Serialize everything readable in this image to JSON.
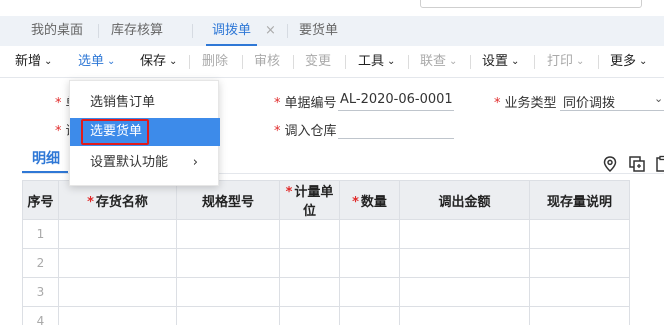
{
  "tabs": [
    {
      "label": "我的桌面",
      "active": false
    },
    {
      "label": "库存核算",
      "active": false
    },
    {
      "label": "调拨单",
      "active": true,
      "closable": true
    },
    {
      "label": "要货单",
      "active": false
    }
  ],
  "tab_close_glyph": "×",
  "toolbar": {
    "items": [
      {
        "label": "新增",
        "dropdown": true,
        "disabled": false
      },
      {
        "label": "选单",
        "dropdown": true,
        "disabled": false,
        "active": true
      },
      {
        "label": "保存",
        "dropdown": true,
        "disabled": false
      },
      {
        "label": "删除",
        "dropdown": false,
        "disabled": true
      },
      {
        "label": "审核",
        "dropdown": false,
        "disabled": true
      },
      {
        "label": "变更",
        "dropdown": false,
        "disabled": true
      },
      {
        "label": "工具",
        "dropdown": true,
        "disabled": false
      },
      {
        "label": "联查",
        "dropdown": true,
        "disabled": true
      },
      {
        "label": "设置",
        "dropdown": true,
        "disabled": false
      },
      {
        "label": "打印",
        "dropdown": true,
        "disabled": true
      },
      {
        "label": "更多",
        "dropdown": true,
        "disabled": false
      }
    ]
  },
  "form": {
    "doc_no_label": "单据编号",
    "doc_no_value": "AL-2020-06-0001",
    "biz_type_label": "业务类型",
    "biz_type_value": "同价调拨",
    "in_warehouse_label": "调入仓库",
    "in_warehouse_value": "",
    "left_label_1_partial": "单",
    "left_label_2_partial": "调"
  },
  "detail_tab": "明细",
  "grid": {
    "columns": [
      {
        "label": "序号",
        "required": false
      },
      {
        "label": "存货名称",
        "required": true
      },
      {
        "label": "规格型号",
        "required": false
      },
      {
        "label": "计量单位",
        "required": true
      },
      {
        "label": "数量",
        "required": true
      },
      {
        "label": "调出金额",
        "required": false
      },
      {
        "label": "现存量说明",
        "required": false
      }
    ],
    "rows": [
      {
        "no": "1"
      },
      {
        "no": "2"
      },
      {
        "no": "3"
      },
      {
        "no": "4"
      }
    ]
  },
  "dropdown": {
    "items": [
      {
        "label": "选销售订单",
        "highlight": false,
        "submenu": false
      },
      {
        "label": "选要货单",
        "highlight": true,
        "submenu": false
      },
      {
        "label": "设置默认功能",
        "highlight": false,
        "submenu": true
      }
    ]
  },
  "icons": {
    "location": "location-icon",
    "copy": "copy-icon",
    "clipboard": "clipboard-icon"
  },
  "colors": {
    "accent": "#2f78d6",
    "highlight": "#3d8bea",
    "required": "#e02b2b",
    "focus_border": "#e11b1b"
  }
}
